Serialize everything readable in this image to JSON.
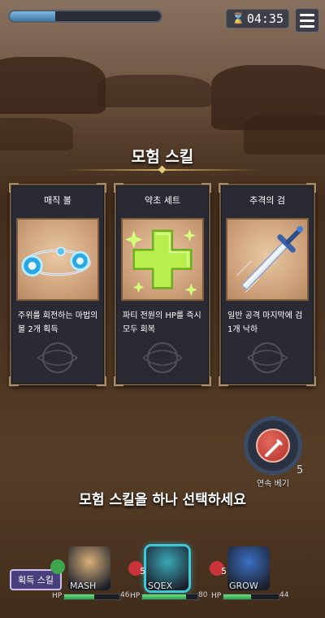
{
  "hud": {
    "progress": 0.3,
    "timer": "04:35"
  },
  "title": "모험 스킬",
  "cards": [
    {
      "title": "매직 볼",
      "desc": "주위를 회전하는 마법의 볼 2개 획득"
    },
    {
      "title": "약초 세트",
      "desc": "파티 전원의 HP를 즉시 모두 회복"
    },
    {
      "title": "추격의 검",
      "desc": "일반 공격 마지막에 검 1개 낙하"
    }
  ],
  "attack": {
    "label": "연속 베기",
    "count": "5"
  },
  "instruction": "모험 스킬을 하나 선택하세요",
  "skill_button": "획득 스킬",
  "party": [
    {
      "name": "MASH",
      "hp_label": "HP",
      "hp_value": "46",
      "hp_fraction": 0.55,
      "level": "",
      "portrait_color": "#d9b07a"
    },
    {
      "name": "SQEX",
      "hp_label": "HP",
      "hp_value": "80",
      "hp_fraction": 0.8,
      "level": "5",
      "portrait_color": "#3aa8b8"
    },
    {
      "name": "GROW",
      "hp_label": "HP",
      "hp_value": "44",
      "hp_fraction": 0.5,
      "level": "5",
      "portrait_color": "#3b6fc4"
    }
  ],
  "colors": {
    "accent_gold": "#c8a860",
    "hp_green": "#2aa34a",
    "card_frame": "#6b5844"
  }
}
